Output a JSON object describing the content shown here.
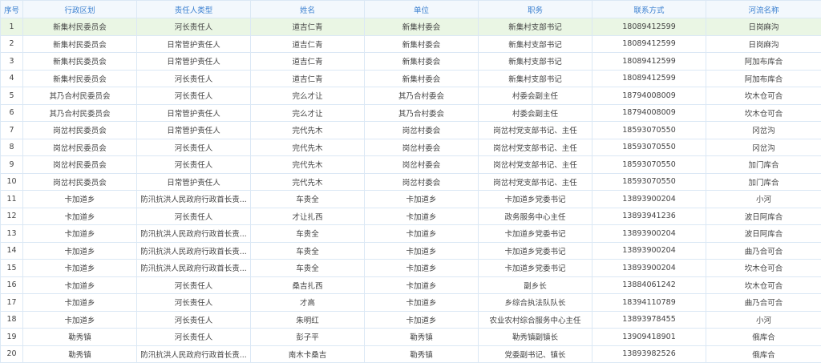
{
  "table": {
    "headers": [
      "序号",
      "行政区划",
      "责任人类型",
      "姓名",
      "单位",
      "职务",
      "联系方式",
      "河流名称"
    ],
    "rows": [
      [
        "1",
        "新集村民委员会",
        "河长责任人",
        "道吉仁青",
        "新集村委会",
        "新集村支部书记",
        "18089412599",
        "日岗麻沟"
      ],
      [
        "2",
        "新集村民委员会",
        "日常管护责任人",
        "道吉仁青",
        "新集村委会",
        "新集村支部书记",
        "18089412599",
        "日岗麻沟"
      ],
      [
        "3",
        "新集村民委员会",
        "日常管护责任人",
        "道吉仁青",
        "新集村委会",
        "新集村支部书记",
        "18089412599",
        "阿加布库合"
      ],
      [
        "4",
        "新集村民委员会",
        "河长责任人",
        "道吉仁青",
        "新集村委会",
        "新集村支部书记",
        "18089412599",
        "阿加布库合"
      ],
      [
        "5",
        "其乃合村民委员会",
        "河长责任人",
        "完么才让",
        "其乃合村委会",
        "村委会副主任",
        "18794008009",
        "坎木仓可合"
      ],
      [
        "6",
        "其乃合村民委员会",
        "日常管护责任人",
        "完么才让",
        "其乃合村委会",
        "村委会副主任",
        "18794008009",
        "坎木仓可合"
      ],
      [
        "7",
        "岗岔村民委员会",
        "日常管护责任人",
        "完代先木",
        "岗岔村委会",
        "岗岔村党支部书记、主任",
        "18593070550",
        "冈岔沟"
      ],
      [
        "8",
        "岗岔村民委员会",
        "河长责任人",
        "完代先木",
        "岗岔村委会",
        "岗岔村党支部书记、主任",
        "18593070550",
        "冈岔沟"
      ],
      [
        "9",
        "岗岔村民委员会",
        "河长责任人",
        "完代先木",
        "岗岔村委会",
        "岗岔村党支部书记、主任",
        "18593070550",
        "加门库合"
      ],
      [
        "10",
        "岗岔村民委员会",
        "日常管护责任人",
        "完代先木",
        "岗岔村委会",
        "岗岔村党支部书记、主任",
        "18593070550",
        "加门库合"
      ],
      [
        "11",
        "卡加道乡",
        "防汛抗洪人民政府行政首长责...",
        "车贵全",
        "卡加道乡",
        "卡加道乡党委书记",
        "13893900204",
        "小河"
      ],
      [
        "12",
        "卡加道乡",
        "河长责任人",
        "才让扎西",
        "卡加道乡",
        "政务服务中心主任",
        "13893941236",
        "波日阿库合"
      ],
      [
        "13",
        "卡加道乡",
        "防汛抗洪人民政府行政首长责...",
        "车贵全",
        "卡加道乡",
        "卡加道乡党委书记",
        "13893900204",
        "波日阿库合"
      ],
      [
        "14",
        "卡加道乡",
        "防汛抗洪人民政府行政首长责...",
        "车贵全",
        "卡加道乡",
        "卡加道乡党委书记",
        "13893900204",
        "曲乃合可合"
      ],
      [
        "15",
        "卡加道乡",
        "防汛抗洪人民政府行政首长责...",
        "车贵全",
        "卡加道乡",
        "卡加道乡党委书记",
        "13893900204",
        "坎木仓可合"
      ],
      [
        "16",
        "卡加道乡",
        "河长责任人",
        "桑吉扎西",
        "卡加道乡",
        "副乡长",
        "13884061242",
        "坎木仓可合"
      ],
      [
        "17",
        "卡加道乡",
        "河长责任人",
        "才高",
        "卡加道乡",
        "乡综合执法队队长",
        "18394110789",
        "曲乃合可合"
      ],
      [
        "18",
        "卡加道乡",
        "河长责任人",
        "朱明红",
        "卡加道乡",
        "农业农村综合服务中心主任",
        "13893978455",
        "小河"
      ],
      [
        "19",
        "勒秀镇",
        "河长责任人",
        "彭子平",
        "勒秀镇",
        "勒秀镇副镇长",
        "13909418901",
        "俄库合"
      ],
      [
        "20",
        "勒秀镇",
        "防汛抗洪人民政府行政首长责...",
        "南木卡桑吉",
        "勒秀镇",
        "党委副书记、镇长",
        "13893982526",
        "俄库合"
      ]
    ],
    "active_row_index": 0
  }
}
